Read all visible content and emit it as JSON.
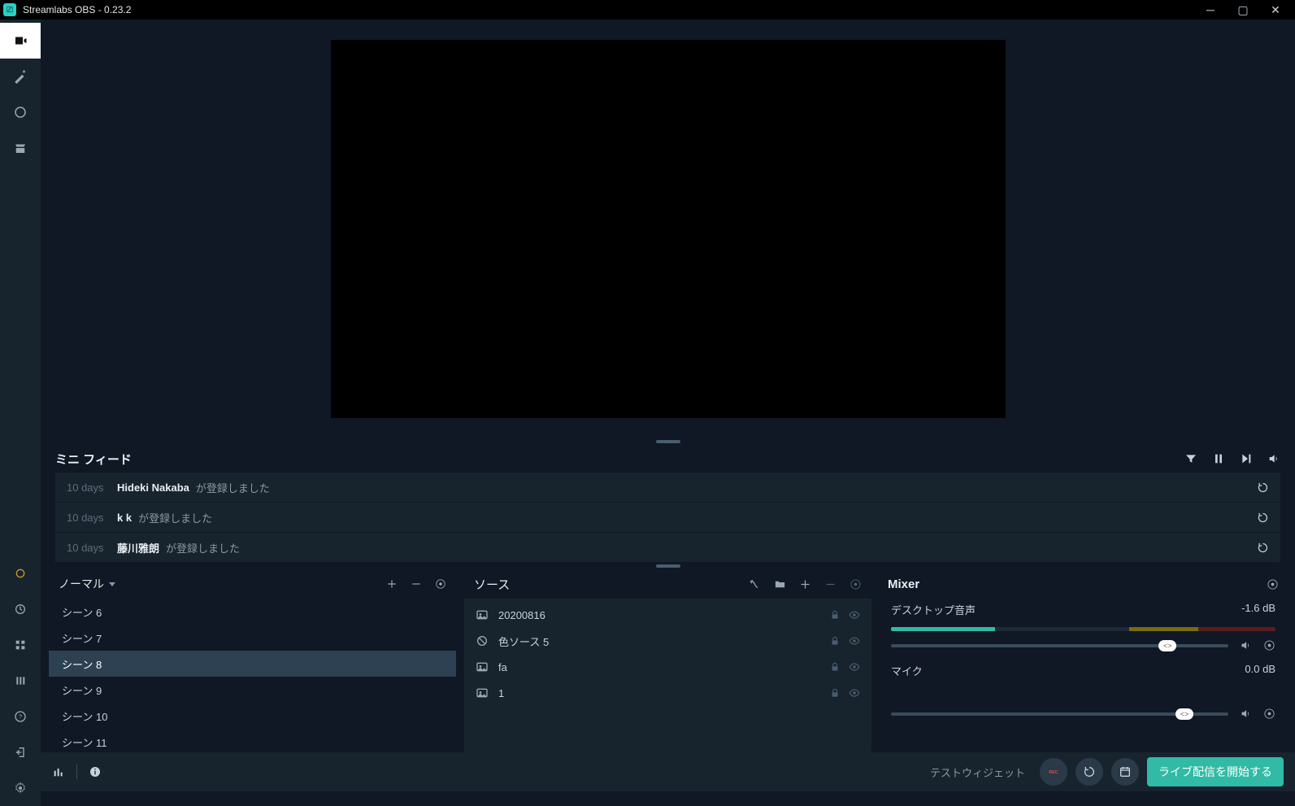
{
  "titlebar": {
    "title": "Streamlabs OBS - 0.23.2"
  },
  "feed": {
    "title": "ミニ フィード",
    "items": [
      {
        "age": "10 days",
        "user": "Hideki Nakaba",
        "msg": "が登録しました"
      },
      {
        "age": "10 days",
        "user": "k k",
        "msg": "が登録しました"
      },
      {
        "age": "10 days",
        "user": "藤川雅朗",
        "msg": "が登録しました"
      }
    ]
  },
  "scenes": {
    "selector": "ノーマル",
    "items": [
      {
        "label": "シーン 6"
      },
      {
        "label": "シーン 7"
      },
      {
        "label": "シーン 8",
        "selected": true
      },
      {
        "label": "シーン 9"
      },
      {
        "label": "シーン 10"
      },
      {
        "label": "シーン 11"
      }
    ]
  },
  "sources": {
    "title": "ソース",
    "items": [
      {
        "icon": "image",
        "label": "20200816"
      },
      {
        "icon": "color",
        "label": "色ソース 5"
      },
      {
        "icon": "image",
        "label": "fa"
      },
      {
        "icon": "image",
        "label": "1"
      }
    ]
  },
  "mixer": {
    "title": "Mixer",
    "channels": [
      {
        "name": "デスクトップ音声",
        "db": "-1.6 dB",
        "level_pct": 27,
        "slider_pct": 82,
        "has_vu": true
      },
      {
        "name": "マイク",
        "db": "0.0 dB",
        "level_pct": 0,
        "slider_pct": 87,
        "has_vu": false
      }
    ]
  },
  "bottom": {
    "test": "テストウィジェット",
    "rec": "REC",
    "golive": "ライブ配信を開始する"
  }
}
